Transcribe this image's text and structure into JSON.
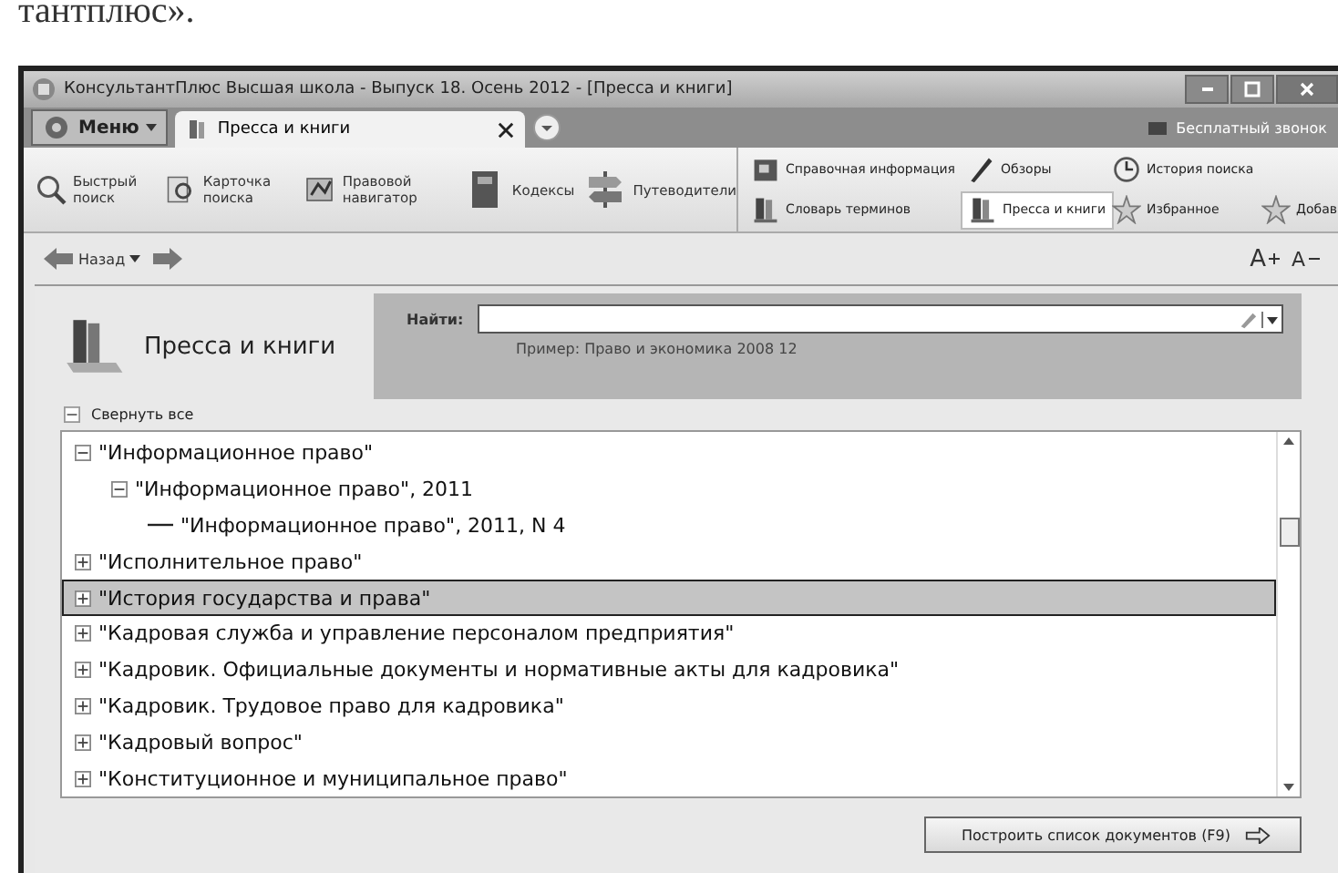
{
  "page_text": "тантплюс».",
  "window": {
    "title": "КонсультантПлюс Высшая школа - Выпуск 18. Осень 2012 - [Пресса и книги]"
  },
  "menu_button": "Меню",
  "tabs": [
    {
      "label": "Пресса и книги",
      "selected": true
    }
  ],
  "tab_bar_link": "Бесплатный звонок",
  "toolbar": [
    {
      "label": "Быстрый поиск",
      "kind": "magnifier"
    },
    {
      "label": "Карточка поиска",
      "kind": "card"
    },
    {
      "label": "Правовой навигатор",
      "kind": "navigator"
    },
    {
      "label": "Кодексы",
      "kind": "book"
    },
    {
      "label": "Путеводители",
      "kind": "signpost"
    }
  ],
  "toolbar_links": [
    [
      {
        "label": "Справочная информация",
        "kind": "info",
        "selected": false
      },
      {
        "label": "Обзоры",
        "kind": "pen",
        "selected": false
      },
      {
        "label": "История поиска",
        "kind": "clock",
        "selected": false
      }
    ],
    [
      {
        "label": "Словарь терминов",
        "kind": "book",
        "selected": false
      },
      {
        "label": "Пресса и книги",
        "kind": "books",
        "selected": true
      },
      {
        "label": "Избранное",
        "kind": "star",
        "selected": false
      },
      {
        "label": "Добав",
        "kind": "star",
        "selected": false
      }
    ]
  ],
  "nav": {
    "back": "Назад",
    "font_larger": "A",
    "font_smaller": "A"
  },
  "section": {
    "title": "Пресса и книги",
    "search_label": "Найти:",
    "example": "Пример: Право и экономика 2008 12"
  },
  "collapse_all": "Свернуть все",
  "tree": [
    {
      "label": "\"Информационное право\"",
      "expanded": true,
      "selected": false,
      "children": [
        {
          "label": "\"Информационное право\", 2011",
          "expanded": true,
          "selected": false,
          "children": [
            {
              "label": "\"Информационное право\", 2011, N 4",
              "selected": false
            }
          ]
        }
      ]
    },
    {
      "label": "\"Исполнительное право\"",
      "expanded": false,
      "selected": false
    },
    {
      "label": "\"История государства и права\"",
      "expanded": false,
      "selected": true
    },
    {
      "label": "\"Кадровая служба и управление персоналом предприятия\"",
      "expanded": false,
      "selected": false
    },
    {
      "label": "\"Кадровик. Официальные документы и нормативные акты для кадровика\"",
      "expanded": false,
      "selected": false
    },
    {
      "label": "\"Кадровик. Трудовое право для кадровика\"",
      "expanded": false,
      "selected": false
    },
    {
      "label": "\"Кадровый вопрос\"",
      "expanded": false,
      "selected": false
    },
    {
      "label": "\"Конституционное и муниципальное право\"",
      "expanded": false,
      "selected": false
    }
  ],
  "build_button": "Построить список документов (F9)"
}
